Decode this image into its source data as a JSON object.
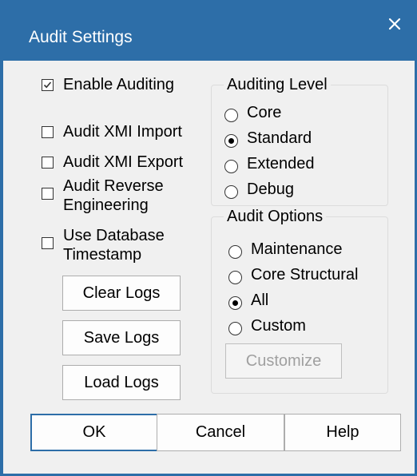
{
  "window": {
    "title": "Audit Settings",
    "close_icon": "close-icon",
    "accent_color": "#2d6ea8"
  },
  "options": {
    "enable_auditing": {
      "label": "Enable Auditing",
      "checked": true
    },
    "audit_xmi_import": {
      "label": "Audit XMI Import",
      "checked": false
    },
    "audit_xmi_export": {
      "label": "Audit XMI Export",
      "checked": false
    },
    "audit_reverse_engineering": {
      "label_line1": "Audit Reverse",
      "label_line2": "Engineering",
      "checked": false
    },
    "use_database_timestamp": {
      "label_line1": "Use Database",
      "label_line2": "Timestamp",
      "checked": false
    }
  },
  "log_buttons": {
    "clear": "Clear Logs",
    "save": "Save Logs",
    "load": "Load Logs"
  },
  "auditing_level": {
    "title": "Auditing Level",
    "options": [
      "Core",
      "Standard",
      "Extended",
      "Debug"
    ],
    "selected": "Standard"
  },
  "audit_options": {
    "title": "Audit Options",
    "options": [
      "Maintenance",
      "Core Structural",
      "All",
      "Custom"
    ],
    "selected": "All",
    "customize_label": "Customize"
  },
  "footer": {
    "ok": "OK",
    "cancel": "Cancel",
    "help": "Help"
  }
}
